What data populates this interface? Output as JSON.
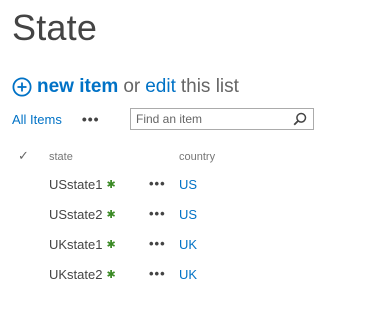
{
  "page": {
    "title": "State"
  },
  "actions": {
    "new_item": "new item",
    "or": "or",
    "edit": "edit",
    "this_list": "this list"
  },
  "view": {
    "all_items": "All Items",
    "more": "•••"
  },
  "search": {
    "placeholder": "Find an item"
  },
  "table": {
    "check_header": "✓",
    "columns": [
      "state",
      "country"
    ],
    "rows": [
      {
        "state": "USstate1",
        "badge": "✱",
        "menu": "•••",
        "country": "US"
      },
      {
        "state": "USstate2",
        "badge": "✱",
        "menu": "•••",
        "country": "US"
      },
      {
        "state": "UKstate1",
        "badge": "✱",
        "menu": "•••",
        "country": "UK"
      },
      {
        "state": "UKstate2",
        "badge": "✱",
        "menu": "•••",
        "country": "UK"
      }
    ]
  },
  "colors": {
    "link": "#0072c6",
    "text": "#444444",
    "new_badge": "#3a8a24"
  },
  "icons": {
    "new_item": "plus-circle-icon",
    "search": "search-icon",
    "new_badge": "new-item-star-icon"
  }
}
